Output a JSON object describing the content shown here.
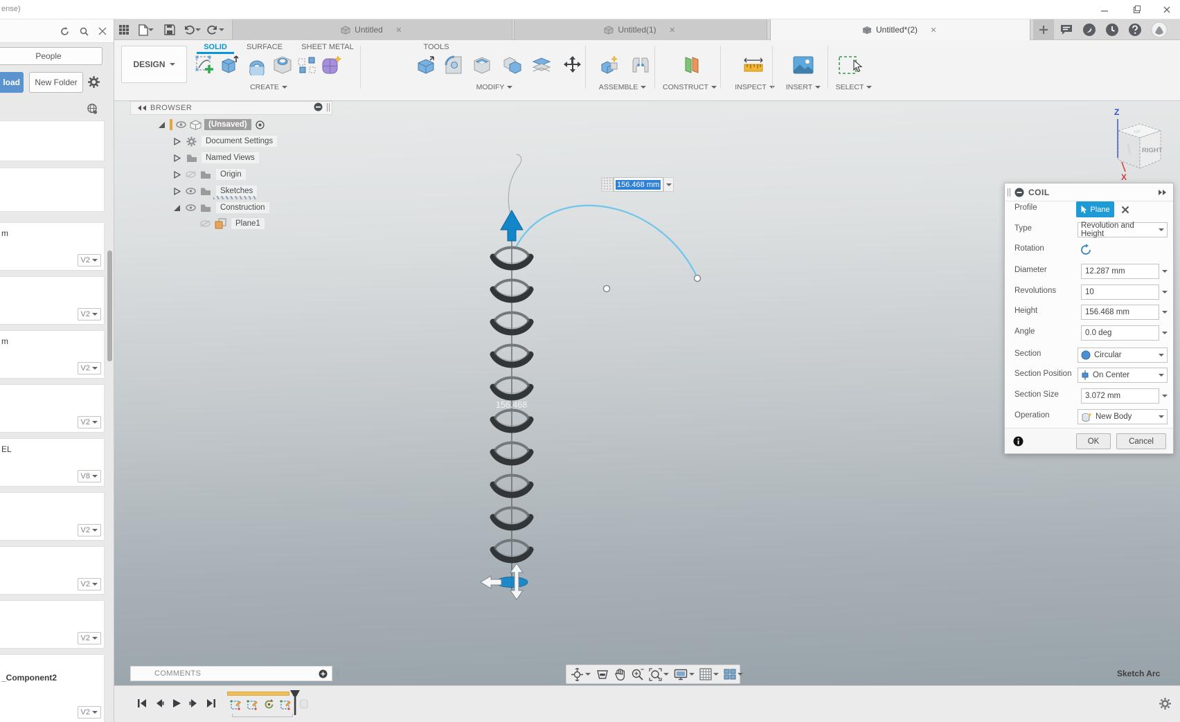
{
  "title_bar": {
    "fragment": "ense)"
  },
  "data_panel": {
    "people_button": "People",
    "upload_button": "load",
    "new_folder_button": "New Folder",
    "cards": [
      {
        "title": "",
        "version": ""
      },
      {
        "title": "",
        "version": ""
      },
      {
        "title": "m",
        "version": "V2"
      },
      {
        "title": "",
        "version": "V2"
      },
      {
        "title": "m",
        "version": "V2"
      },
      {
        "title": "",
        "version": "V2"
      },
      {
        "title": "EL",
        "version": "V8"
      },
      {
        "title": "",
        "version": "V2"
      },
      {
        "title": "",
        "version": "V2"
      },
      {
        "title": "",
        "version": "V2"
      },
      {
        "title": "_Component2",
        "version": "V2"
      }
    ]
  },
  "document_tabs": {
    "tabs": [
      {
        "label": "Untitled"
      },
      {
        "label": "Untitled(1)"
      },
      {
        "label": "Untitled*(2)"
      }
    ]
  },
  "ribbon": {
    "design_menu_label": "DESIGN",
    "tabs": [
      {
        "label": "SOLID"
      },
      {
        "label": "SURFACE"
      },
      {
        "label": "SHEET METAL"
      },
      {
        "label": "TOOLS"
      }
    ],
    "groups": [
      {
        "label": "CREATE"
      },
      {
        "label": "MODIFY"
      },
      {
        "label": "ASSEMBLE"
      },
      {
        "label": "CONSTRUCT"
      },
      {
        "label": "INSPECT"
      },
      {
        "label": "INSERT"
      },
      {
        "label": "SELECT"
      }
    ],
    "accent_color": "#0696d7"
  },
  "browser_panel": {
    "title": "BROWSER",
    "root_label": "(Unsaved)",
    "items": [
      {
        "label": "Document Settings"
      },
      {
        "label": "Named Views"
      },
      {
        "label": "Origin"
      },
      {
        "label": "Sketches"
      },
      {
        "label": "Construction"
      },
      {
        "label": "Plane1"
      }
    ]
  },
  "viewport": {
    "dimension_input": {
      "value": "156.468 mm"
    },
    "coil_height_label": "156.468",
    "status_hint": "Sketch Arc",
    "view_cube": {
      "front_face": "RIGHT",
      "top_face": "TOP",
      "side_face": "FRONT",
      "z_axis": "Z",
      "x_axis": "X"
    }
  },
  "coil_dialog": {
    "title": "COIL",
    "profile": {
      "label": "Profile",
      "value": "Plane"
    },
    "type": {
      "label": "Type",
      "value": "Revolution and Height"
    },
    "rotation": {
      "label": "Rotation"
    },
    "diameter": {
      "label": "Diameter",
      "value": "12.287 mm"
    },
    "revolutions": {
      "label": "Revolutions",
      "value": "10"
    },
    "height": {
      "label": "Height",
      "value": "156.468 mm"
    },
    "angle": {
      "label": "Angle",
      "value": "0.0 deg"
    },
    "section": {
      "label": "Section",
      "value": "Circular"
    },
    "section_position": {
      "label": "Section Position",
      "value": "On Center"
    },
    "section_size": {
      "label": "Section Size",
      "value": "3.072 mm"
    },
    "operation": {
      "label": "Operation",
      "value": "New Body"
    },
    "ok_button": "OK",
    "cancel_button": "Cancel"
  },
  "comments_bar": {
    "label": "COMMENTS"
  }
}
